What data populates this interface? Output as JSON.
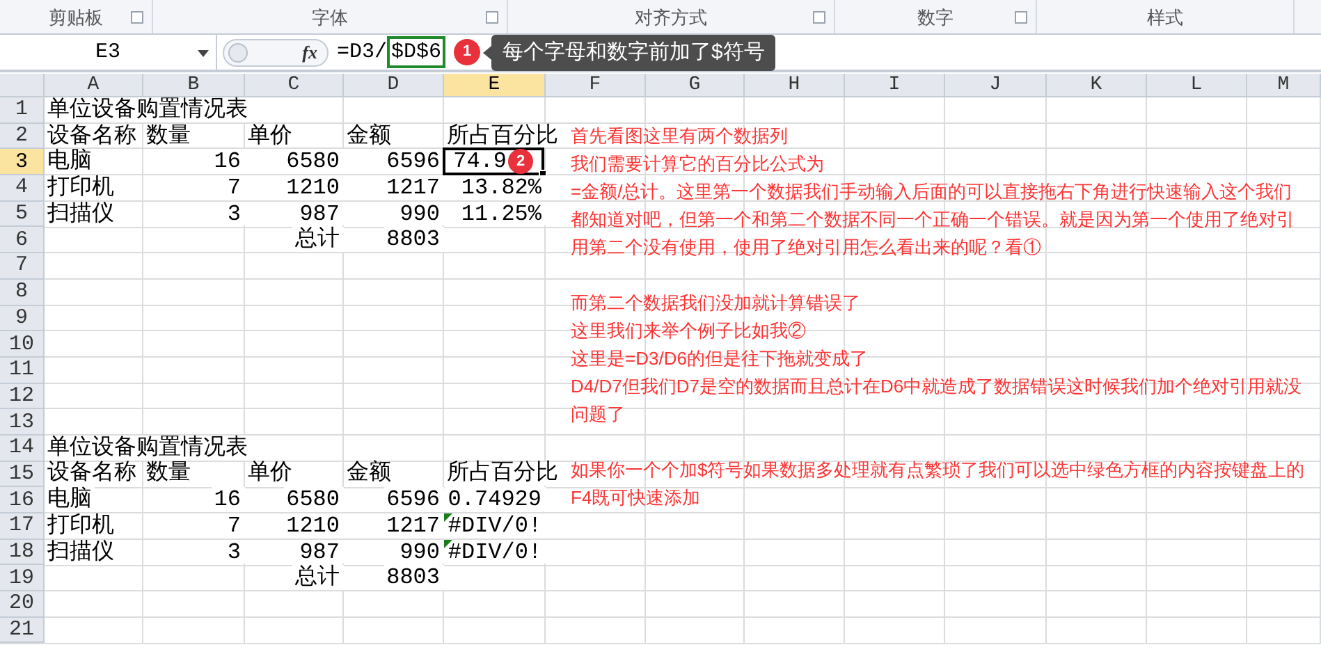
{
  "ribbon_groups": [
    {
      "label": "剪贴板",
      "launcher": true
    },
    {
      "label": "字体",
      "launcher": true
    },
    {
      "label": "对齐方式",
      "launcher": true
    },
    {
      "label": "数字",
      "launcher": true
    },
    {
      "label": "样式",
      "launcher": false
    }
  ],
  "formula_bar": {
    "name_box": "E3",
    "function_label": "fx",
    "formula": "=D3/",
    "highlighted": "$D$6",
    "badge": "1",
    "tooltip": "每个字母和数字前加了$符号"
  },
  "columns": [
    {
      "label": "A",
      "selected": false
    },
    {
      "label": "B",
      "selected": false
    },
    {
      "label": "C",
      "selected": false
    },
    {
      "label": "D",
      "selected": false
    },
    {
      "label": "E",
      "selected": true
    },
    {
      "label": "F",
      "selected": false
    },
    {
      "label": "G",
      "selected": false
    },
    {
      "label": "H",
      "selected": false
    },
    {
      "label": "I",
      "selected": false
    },
    {
      "label": "J",
      "selected": false
    },
    {
      "label": "K",
      "selected": false
    },
    {
      "label": "L",
      "selected": false
    },
    {
      "label": "M",
      "selected": false
    }
  ],
  "rows": [
    {
      "label": "1",
      "selected": false,
      "cells": [
        {
          "text": "单位设备购置情况表",
          "kind": "label"
        }
      ]
    },
    {
      "label": "2",
      "selected": false,
      "cells": [
        {
          "text": "设备名称",
          "kind": "label"
        },
        {
          "text": "数量",
          "kind": "label"
        },
        {
          "text": "单价",
          "kind": "label"
        },
        {
          "text": "金额",
          "kind": "label"
        },
        {
          "text": "所占百分比",
          "kind": "label"
        }
      ]
    },
    {
      "label": "3",
      "selected": true,
      "cells": [
        {
          "text": "电脑",
          "kind": "label"
        },
        {
          "text": "16",
          "kind": "number"
        },
        {
          "text": "6580",
          "kind": "number"
        },
        {
          "text": "6596",
          "kind": "number"
        },
        {
          "text": "74.9",
          "kind": "active",
          "badge": "2"
        }
      ]
    },
    {
      "label": "4",
      "selected": false,
      "cells": [
        {
          "text": "打印机",
          "kind": "label"
        },
        {
          "text": "7",
          "kind": "number"
        },
        {
          "text": "1210",
          "kind": "number"
        },
        {
          "text": "1217",
          "kind": "number"
        },
        {
          "text": "13.82%",
          "kind": "number"
        }
      ]
    },
    {
      "label": "5",
      "selected": false,
      "cells": [
        {
          "text": "扫描仪",
          "kind": "label"
        },
        {
          "text": "3",
          "kind": "number"
        },
        {
          "text": "987",
          "kind": "number"
        },
        {
          "text": "990",
          "kind": "number"
        },
        {
          "text": "11.25%",
          "kind": "number"
        }
      ]
    },
    {
      "label": "6",
      "selected": false,
      "cells": [
        null,
        null,
        {
          "text": "总计",
          "kind": "number"
        },
        {
          "text": "8803",
          "kind": "number"
        }
      ]
    },
    {
      "label": "7",
      "selected": false
    },
    {
      "label": "8",
      "selected": false
    },
    {
      "label": "9",
      "selected": false
    },
    {
      "label": "10",
      "selected": false
    },
    {
      "label": "11",
      "selected": false
    },
    {
      "label": "12",
      "selected": false
    },
    {
      "label": "13",
      "selected": false
    },
    {
      "label": "14",
      "selected": false,
      "cells": [
        {
          "text": "单位设备购置情况表",
          "kind": "label"
        }
      ]
    },
    {
      "label": "15",
      "selected": false,
      "cells": [
        {
          "text": "设备名称",
          "kind": "label"
        },
        {
          "text": "数量",
          "kind": "label"
        },
        {
          "text": "单价",
          "kind": "label"
        },
        {
          "text": "金额",
          "kind": "label"
        },
        {
          "text": "所占百分比",
          "kind": "label"
        }
      ]
    },
    {
      "label": "16",
      "selected": false,
      "cells": [
        {
          "text": "电脑",
          "kind": "label"
        },
        {
          "text": "16",
          "kind": "number"
        },
        {
          "text": "6580",
          "kind": "number"
        },
        {
          "text": "6596",
          "kind": "number"
        },
        {
          "text": "0.74929",
          "kind": "number"
        }
      ]
    },
    {
      "label": "17",
      "selected": false,
      "cells": [
        {
          "text": "打印机",
          "kind": "label"
        },
        {
          "text": "7",
          "kind": "number"
        },
        {
          "text": "1210",
          "kind": "number"
        },
        {
          "text": "1217",
          "kind": "number"
        },
        {
          "text": "#DIV/0!",
          "kind": "error"
        }
      ]
    },
    {
      "label": "18",
      "selected": false,
      "cells": [
        {
          "text": "扫描仪",
          "kind": "label"
        },
        {
          "text": "3",
          "kind": "number"
        },
        {
          "text": "987",
          "kind": "number"
        },
        {
          "text": "990",
          "kind": "number"
        },
        {
          "text": "#DIV/0!",
          "kind": "error"
        }
      ]
    },
    {
      "label": "19",
      "selected": false,
      "cells": [
        null,
        null,
        {
          "text": "总计",
          "kind": "number"
        },
        {
          "text": "8803",
          "kind": "number"
        }
      ]
    },
    {
      "label": "20",
      "selected": false
    },
    {
      "label": "21",
      "selected": false
    }
  ],
  "annotation": {
    "blocks": [
      [
        "首先看图这里有两个数据列",
        "我们需要计算它的百分比公式为",
        "=金额/总计。这里第一个数据我们手动输入后面的可以直接拖右下角进行快速输入这个我们都知道对吧，但第一个和第二个数据不同一个正确一个错误。就是因为第一个使用了绝对引用第二个没有使用，使用了绝对引用怎么看出来的呢？看①"
      ],
      [
        "而第二个数据我们没加就计算错误了",
        "这里我们来举个例子比如我②",
        "这里是=D3/D6的但是往下拖就变成了",
        "D4/D7但我们D7是空的数据而且总计在D6中就造成了数据错误这时候我们加个绝对引用就没问题了"
      ],
      [
        "如果你一个个加$符号如果数据多处理就有点繁琐了我们可以选中绿色方框的内容按键盘上的F4既可快速添加"
      ]
    ]
  }
}
